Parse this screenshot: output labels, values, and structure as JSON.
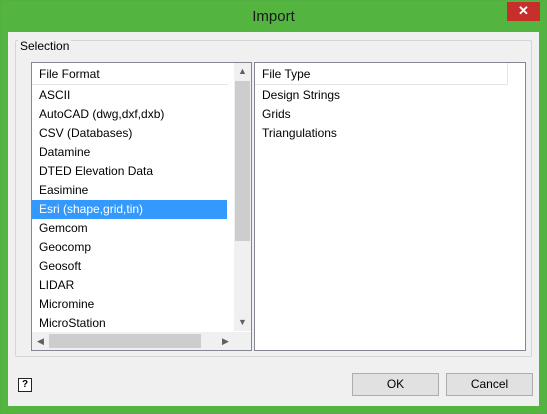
{
  "window": {
    "title": "Import",
    "close_glyph": "✕"
  },
  "selection": {
    "group_label": "Selection",
    "file_format": {
      "header": "File Format",
      "items": [
        "ASCII",
        "AutoCAD (dwg,dxf,dxb)",
        "CSV (Databases)",
        "Datamine",
        "DTED Elevation Data",
        "Easimine",
        "Esri (shape,grid,tin)",
        "Gemcom",
        "Geocomp",
        "Geosoft",
        "LIDAR",
        "Micromine",
        "MicroStation"
      ],
      "selected": "Esri (shape,grid,tin)"
    },
    "file_type": {
      "header": "File Type",
      "items": [
        "Design Strings",
        "Grids",
        "Triangulations"
      ]
    }
  },
  "footer": {
    "help_glyph": "?",
    "ok_label": "OK",
    "cancel_label": "Cancel"
  },
  "colors": {
    "title_bar": "#53b440",
    "close_button": "#c7302a",
    "selection": "#3399ff"
  }
}
